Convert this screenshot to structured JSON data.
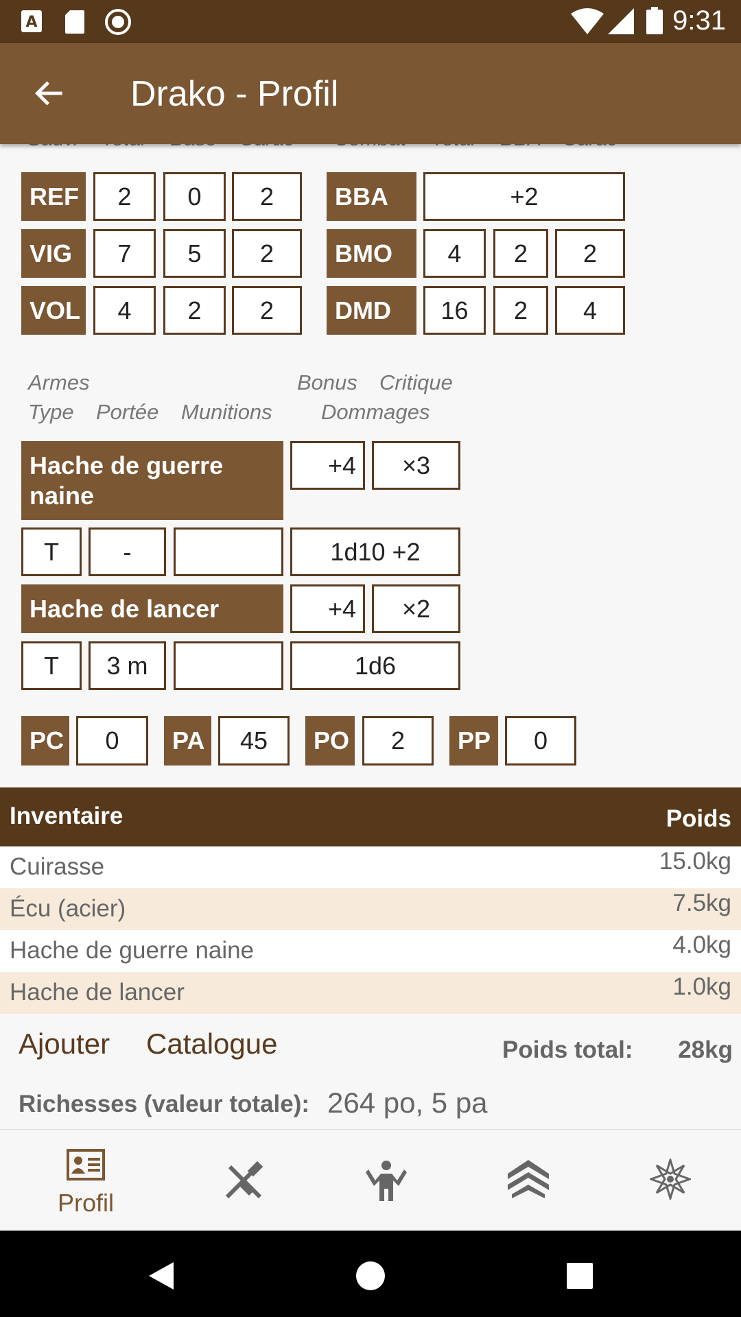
{
  "status_bar": {
    "time": "9:31",
    "icons": [
      "a-notification-icon",
      "sd-card-icon",
      "record-icon",
      "wifi-icon",
      "signal-icon",
      "battery-icon"
    ]
  },
  "app_bar": {
    "title": "Drako - Profil",
    "back_icon": "arrow-left-icon"
  },
  "saves": {
    "headers": [
      "Sauv.",
      "Total",
      "Base",
      "Carac"
    ],
    "rows": [
      {
        "label": "REF",
        "total": "2",
        "base": "0",
        "carac": "2"
      },
      {
        "label": "VIG",
        "total": "7",
        "base": "5",
        "carac": "2"
      },
      {
        "label": "VOL",
        "total": "4",
        "base": "2",
        "carac": "2"
      }
    ]
  },
  "combat": {
    "headers": [
      "Combat",
      "Total",
      "BBA",
      "Carac"
    ],
    "bba": {
      "label": "BBA",
      "value": "+2"
    },
    "bmo": {
      "label": "BMO",
      "total": "4",
      "bba": "2",
      "carac": "2"
    },
    "dmd": {
      "label": "DMD",
      "total": "16",
      "bba": "2",
      "carac": "4"
    }
  },
  "weapons": {
    "caption": {
      "armes": "Armes",
      "type": "Type",
      "portee": "Portée",
      "munitions": "Munitions",
      "bonus": "Bonus",
      "critique": "Critique",
      "dommages": "Dommages"
    },
    "items": [
      {
        "name": "Hache de guerre naine",
        "bonus": "+4",
        "critique": "×3",
        "type": "T",
        "portee": "-",
        "munitions": "",
        "dommages": "1d10 +2"
      },
      {
        "name": "Hache de lancer",
        "bonus": "+4",
        "critique": "×2",
        "type": "T",
        "portee": "3 m",
        "munitions": "",
        "dommages": "1d6"
      }
    ]
  },
  "coins": [
    {
      "label": "PC",
      "value": "0"
    },
    {
      "label": "PA",
      "value": "45"
    },
    {
      "label": "PO",
      "value": "2"
    },
    {
      "label": "PP",
      "value": "0"
    }
  ],
  "inventory": {
    "title": "Inventaire",
    "weight_header": "Poids",
    "items": [
      {
        "name": "Cuirasse",
        "weight": "15.0kg"
      },
      {
        "name": "Écu (acier)",
        "weight": "7.5kg"
      },
      {
        "name": "Hache de guerre naine",
        "weight": "4.0kg"
      },
      {
        "name": "Hache de lancer",
        "weight": "1.0kg"
      }
    ],
    "add_label": "Ajouter",
    "catalog_label": "Catalogue",
    "total_label": "Poids total:",
    "total_value": "28kg",
    "wealth_label": "Richesses (valeur totale):",
    "wealth_value": "264 po, 5 pa"
  },
  "bottom_nav": {
    "profil_label": "Profil",
    "items": [
      "profile-card-icon",
      "weapons-icon",
      "character-icon",
      "rank-icon",
      "magic-star-icon"
    ]
  },
  "colors": {
    "primary": "#7c5734",
    "primary_dark": "#56381a",
    "row_alt": "#f7eadb"
  }
}
